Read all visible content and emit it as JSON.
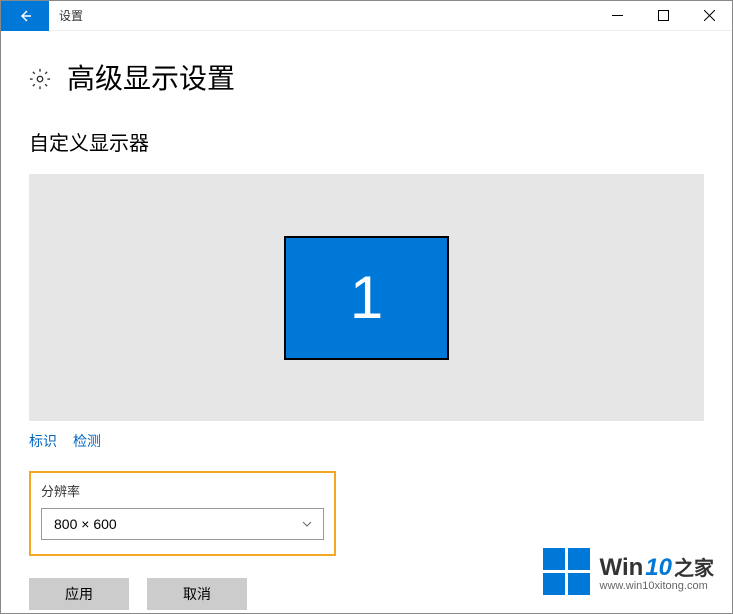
{
  "titlebar": {
    "title": "设置"
  },
  "header": {
    "page_title": "高级显示设置"
  },
  "section": {
    "customize_title": "自定义显示器",
    "monitor_number": "1",
    "identify_link": "标识",
    "detect_link": "检测"
  },
  "resolution": {
    "label": "分辨率",
    "selected": "800 × 600"
  },
  "buttons": {
    "apply": "应用",
    "cancel": "取消"
  },
  "watermark": {
    "win": "Win",
    "ten": "10",
    "home": "之家",
    "url": "www.win10xitong.com"
  }
}
